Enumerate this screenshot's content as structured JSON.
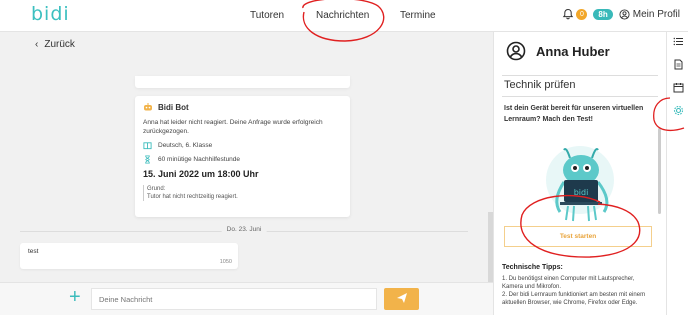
{
  "header": {
    "logo": "bidi",
    "nav": [
      "Tutoren",
      "Nachrichten",
      "Termine"
    ],
    "notification_count": "0",
    "hours_badge": "8h",
    "profile_label": "Mein Profil"
  },
  "chat": {
    "back_label": "Zurück",
    "bot_card": {
      "sender": "Bidi Bot",
      "message": "Anna hat leider nicht reagiert. Deine Anfrage wurde erfolgreich zurückgezogen.",
      "subject": "Deutsch, 6. Klasse",
      "duration": "60 minütige Nachhilfestunde",
      "datetime": "15. Juni 2022 um 18:00 Uhr",
      "reason_label": "Grund:",
      "reason": "Tutor hat nicht rechtzeitig reagiert."
    },
    "date_separator": "Do. 23. Juni",
    "message": {
      "text": "test",
      "time": "1050"
    },
    "composer_placeholder": "Deine Nachricht"
  },
  "panel": {
    "user_name": "Anna Huber",
    "section_title": "Technik prüfen",
    "question": "Ist dein Gerät bereit für unseren virtuellen Lernraum? Mach den Test!",
    "illustration_text": "bidi",
    "test_button": "Test starten",
    "tips_title": "Technische Tipps:",
    "tips": [
      "1. Du benötigst einen Computer mit Lautsprecher, Kamera und Mikrofon.",
      "2. Der bidi Lernraum funktioniert am besten mit einem aktuellen Browser, wie Chrome, Firefox oder Edge."
    ]
  },
  "colors": {
    "brand": "#3cc0c0",
    "accent": "#f2b34a",
    "annotation": "#e02020"
  },
  "icons": [
    "list-icon",
    "document-icon",
    "calendar-icon",
    "gear-icon",
    "bell-icon",
    "user-circle-icon",
    "send-icon",
    "plus-icon",
    "chevron-left-icon"
  ]
}
